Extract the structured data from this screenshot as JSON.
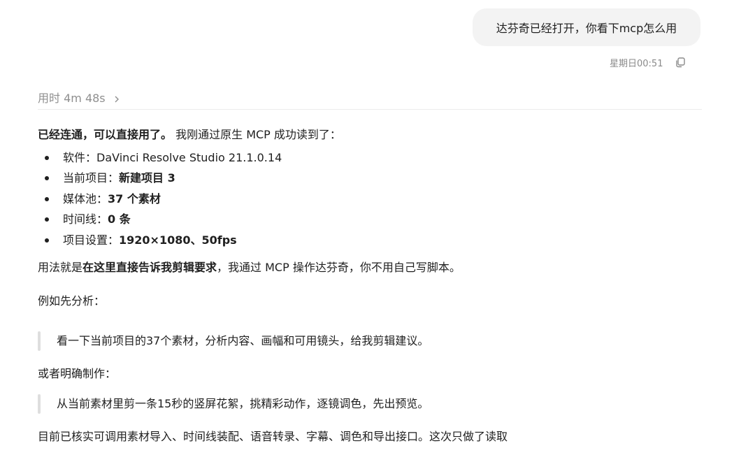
{
  "user_message": {
    "text": "达芬奇已经打开，你看下mcp怎么用",
    "timestamp": "星期日00:51",
    "copy_icon": "copy-icon"
  },
  "thinking": {
    "label": "用时 4m 48s",
    "chevron_icon": "chevron-right-icon"
  },
  "answer": {
    "intro_bold": "已经连通，可以直接用了。",
    "intro_rest": " 我刚通过原生 MCP 成功读到了：",
    "bullets": [
      {
        "label": "软件：",
        "value": "DaVinci Resolve Studio 21.1.0.14"
      },
      {
        "label": "当前项目：",
        "value": "新建项目 3"
      },
      {
        "label": "媒体池：",
        "value": "37 个素材"
      },
      {
        "label": "时间线：",
        "value": "0 条"
      },
      {
        "label": "项目设置：",
        "value": "1920×1080、50fps"
      }
    ],
    "usage_pre": "用法就是",
    "usage_bold": "在这里直接告诉我剪辑要求",
    "usage_post": "，我通过 MCP 操作达芬奇，你不用自己写脚本。",
    "example_label": "例如先分析：",
    "example_quote": "看一下当前项目的37个素材，分析内容、画幅和可用镜头，给我剪辑建议。",
    "or_label": "或者明确制作：",
    "make_quote": "从当前素材里剪一条15秒的竖屏花絮，挑精彩动作，逐镜调色，先出预览。",
    "final_text": "目前已核实可调用素材导入、时间线装配、语音转录、字幕、调色和导出接口。这次只做了读取"
  }
}
